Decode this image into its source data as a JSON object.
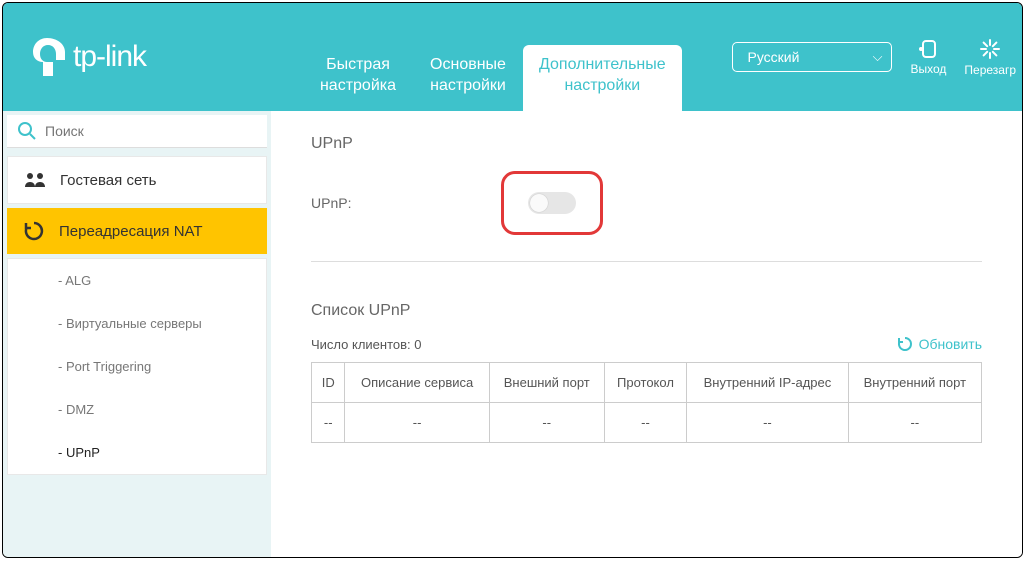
{
  "brand": "tp-link",
  "nav": {
    "quick": "Быстрая\nнастройка",
    "basic": "Основные\nнастройки",
    "advanced": "Дополнительные\nнастройки"
  },
  "lang": "Русский",
  "btn_logout": "Выход",
  "btn_reload": "Перезагр",
  "search_placeholder": "Поиск",
  "sidebar": {
    "guest": "Гостевая сеть",
    "nat": "Переадресация NAT",
    "sub": {
      "alg": "- ALG",
      "vs": "- Виртуальные серверы",
      "pt": "- Port Triggering",
      "dmz": "- DMZ",
      "upnp": "- UPnP"
    }
  },
  "main": {
    "title1": "UPnP",
    "label": "UPnP:",
    "title2": "Список UPnP",
    "clients_label": "Число клиентов: 0",
    "refresh": "Обновить",
    "th": {
      "id": "ID",
      "desc": "Описание сервиса",
      "ext": "Внешний порт",
      "proto": "Протокол",
      "ip": "Внутренний IP-адрес",
      "int": "Внутренний порт"
    },
    "empty": "--"
  }
}
